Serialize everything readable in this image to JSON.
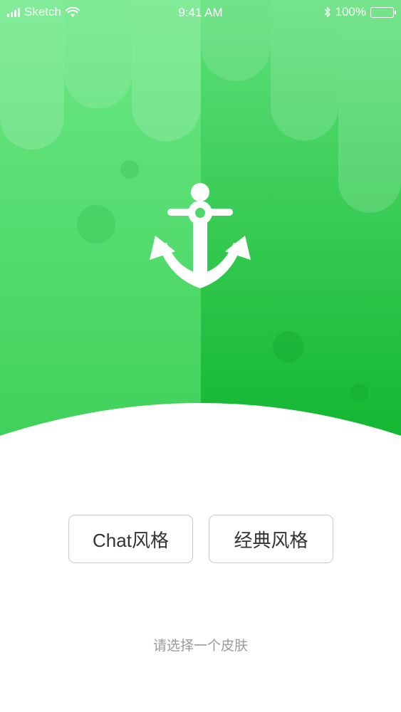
{
  "status_bar": {
    "carrier": "Sketch",
    "time": "9:41 AM",
    "battery": "100%"
  },
  "icons": {
    "signal": "signal-bars-icon",
    "wifi": "wifi-icon",
    "bluetooth": "bluetooth-icon",
    "battery": "battery-icon",
    "hero": "anchor-icon"
  },
  "colors": {
    "green_light": "#5fe07a",
    "green_dark": "#14b833",
    "button_border": "#c9c9c9",
    "hint_text": "#9a9a9a"
  },
  "skin_options": [
    {
      "label": "Chat风格"
    },
    {
      "label": "经典风格"
    }
  ],
  "hint": "请选择一个皮肤"
}
